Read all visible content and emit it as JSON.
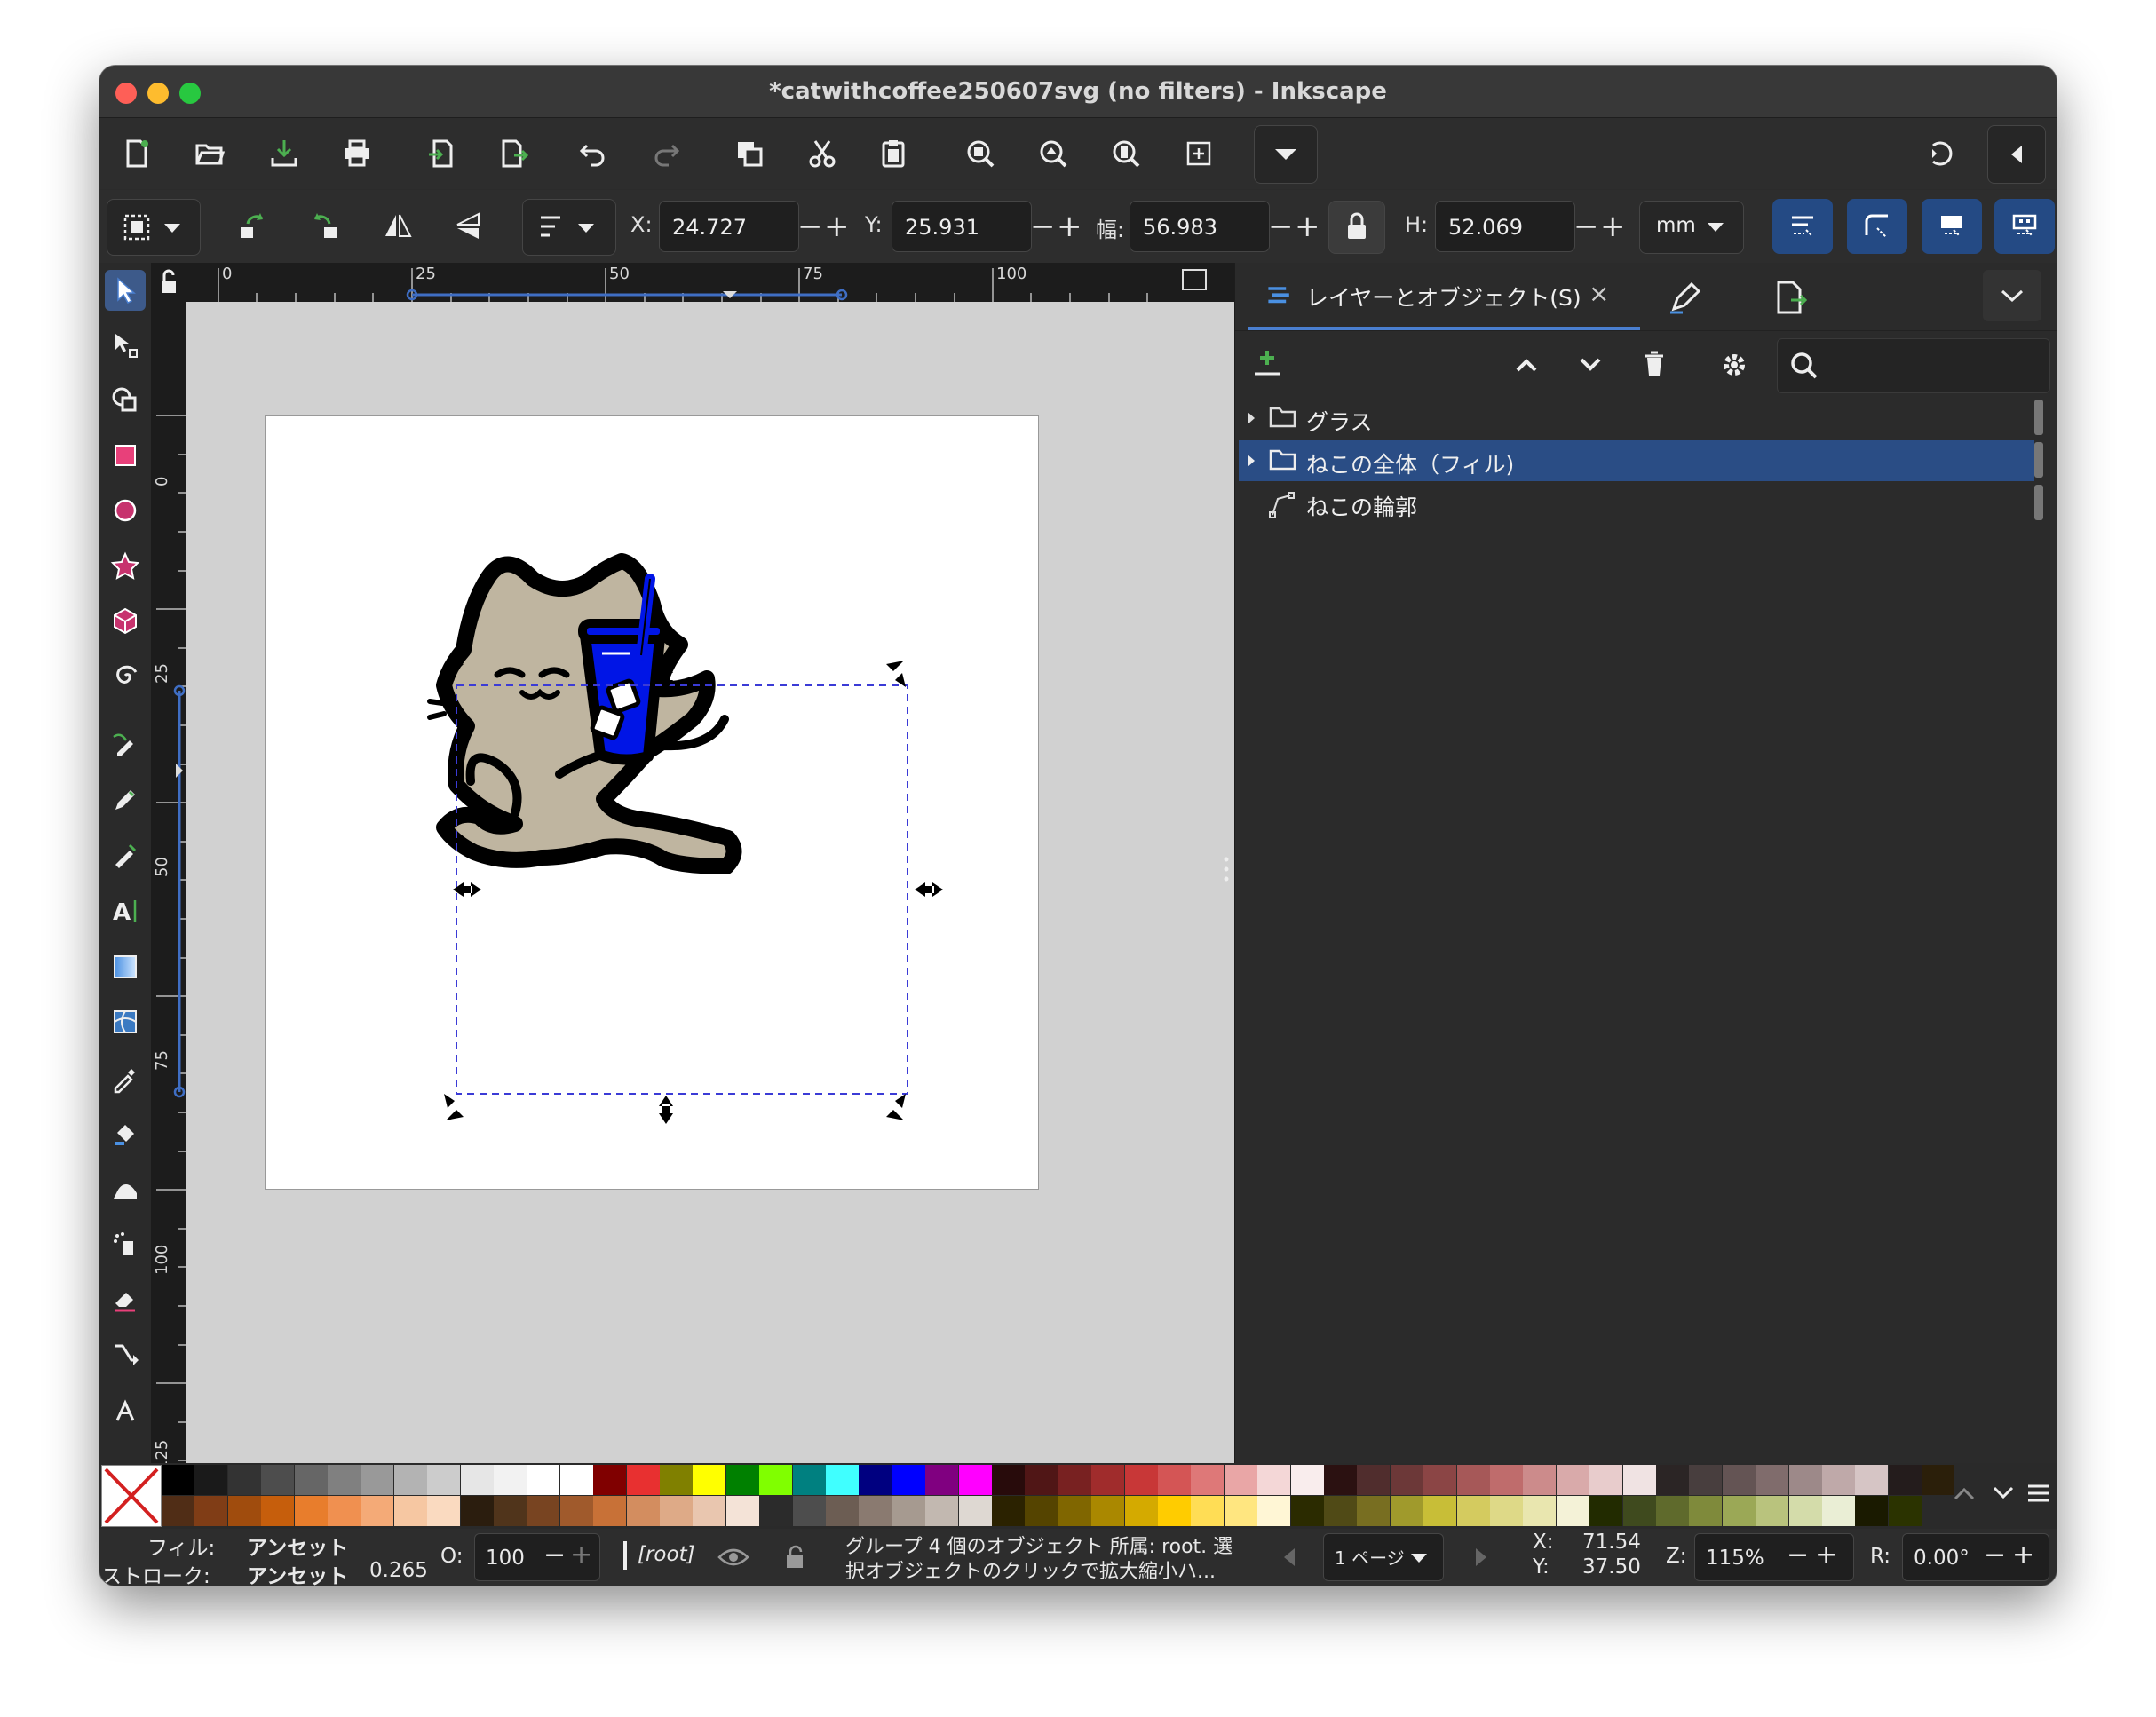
{
  "window": {
    "title": "*catwithcoffee250607svg (no filters) - Inkscape"
  },
  "commands": [
    "new-document",
    "open",
    "save",
    "print",
    "import",
    "export",
    "undo",
    "redo",
    "duplicate",
    "cut",
    "paste",
    "zoom-selection",
    "zoom-drawing",
    "zoom-page",
    "zoom-center",
    "more",
    "snap-toggle",
    "panel-collapse"
  ],
  "controls": {
    "x_label": "X:",
    "x_value": "24.727",
    "y_label": "Y:",
    "y_value": "25.931",
    "w_label": "幅:",
    "w_value": "56.983",
    "h_label": "H:",
    "h_value": "52.069",
    "unit": "mm",
    "minus": "−",
    "plus": "+"
  },
  "ruler": {
    "h_labels": [
      "0",
      "25",
      "50",
      "75",
      "100"
    ],
    "v_labels": [
      "0",
      "25",
      "50",
      "75",
      "100",
      "125"
    ]
  },
  "panel": {
    "tab_label": "レイヤーとオブジェクト(S)",
    "tab_close": "×",
    "objects": [
      {
        "label": "グラス",
        "type": "group",
        "selected": false
      },
      {
        "label": "ねこの全体（フィル)",
        "type": "group",
        "selected": true
      },
      {
        "label": "ねこの輪郭",
        "type": "path",
        "selected": false
      }
    ]
  },
  "palette": {
    "row1": [
      "#000000",
      "#1a1a1a",
      "#333333",
      "#4d4d4d",
      "#666666",
      "#808080",
      "#999999",
      "#b3b3b3",
      "#cccccc",
      "#e6e6e6",
      "#f2f2f2",
      "#ffffff",
      "#ffffff",
      "#800000",
      "#e83030",
      "#808000",
      "#ffff00",
      "#008000",
      "#80ff00",
      "#008080",
      "#40ffff",
      "#000080",
      "#0000ff",
      "#800080",
      "#ff00ff",
      "#280b0b",
      "#501616",
      "#782121",
      "#a02c2c",
      "#c83737",
      "#d45555",
      "#de7878",
      "#e9a6a6",
      "#f4d7d7",
      "#f9eded",
      "#2b1111",
      "#502d2d",
      "#6c3838",
      "#8b4545",
      "#a65858",
      "#bf6c6c",
      "#cc8b8b",
      "#d9aaaa",
      "#e8cccc",
      "#f0e3e3",
      "#2b2525",
      "#483e3e",
      "#645454",
      "#806c6c",
      "#9d8989",
      "#bfa9a9",
      "#d6c5c5",
      "#241c1c",
      "#2b1f0a"
    ],
    "row2": [
      "#502d16",
      "#803d16",
      "#a04c0d",
      "#c65e0c",
      "#e87d2c",
      "#f09050",
      "#f4aa77",
      "#f6c7a2",
      "#fadac0",
      "#2b1d0e",
      "#50341b",
      "#784421",
      "#a05a2c",
      "#c87137",
      "#d38d5f",
      "#deaa87",
      "#e9c6af",
      "#f4e3d7",
      "#2b2b2b",
      "#4d4d4d",
      "#6c5d53",
      "#8a7a70",
      "#a69a90",
      "#c2b8b0",
      "#ded8d2",
      "#2b2200",
      "#554400",
      "#806600",
      "#aa8800",
      "#d4aa00",
      "#ffcc00",
      "#ffdd55",
      "#ffe680",
      "#fff6d5",
      "#2b2b00",
      "#504a16",
      "#786e21",
      "#a09a2c",
      "#c8be37",
      "#d4cb5f",
      "#ded987",
      "#e9e6af",
      "#f4f2d7",
      "#222b00",
      "#3f4a1e",
      "#5f6a2c",
      "#7f8a3b",
      "#9ba856",
      "#b9c37d",
      "#d4dcaa",
      "#eaeed5",
      "#1a1a00",
      "#2b3300"
    ]
  },
  "status": {
    "fill_label": "フィル:",
    "fill_value": "アンセット",
    "stroke_label": "ストローク:",
    "stroke_value": "アンセット",
    "stroke_width": "0.265",
    "opacity_label": "O:",
    "opacity_value": "100",
    "layer": "[root]",
    "message_line1": "グループ 4 個のオブジェクト 所属: root. 選",
    "message_line2": "択オブジェクトのクリックで拡大縮小ハ...",
    "page": "1 ページ",
    "cx_label": "X:",
    "cx": "71.54",
    "cy_label": "Y:",
    "cy": "37.50",
    "zoom_label": "Z:",
    "zoom": "115%",
    "rot_label": "R:",
    "rotation": "0.00°"
  },
  "colors": {
    "accent": "#2a4d85",
    "cat_fill": "#bfb5a0",
    "glass_blue": "#0015e6",
    "outline": "#000000"
  }
}
